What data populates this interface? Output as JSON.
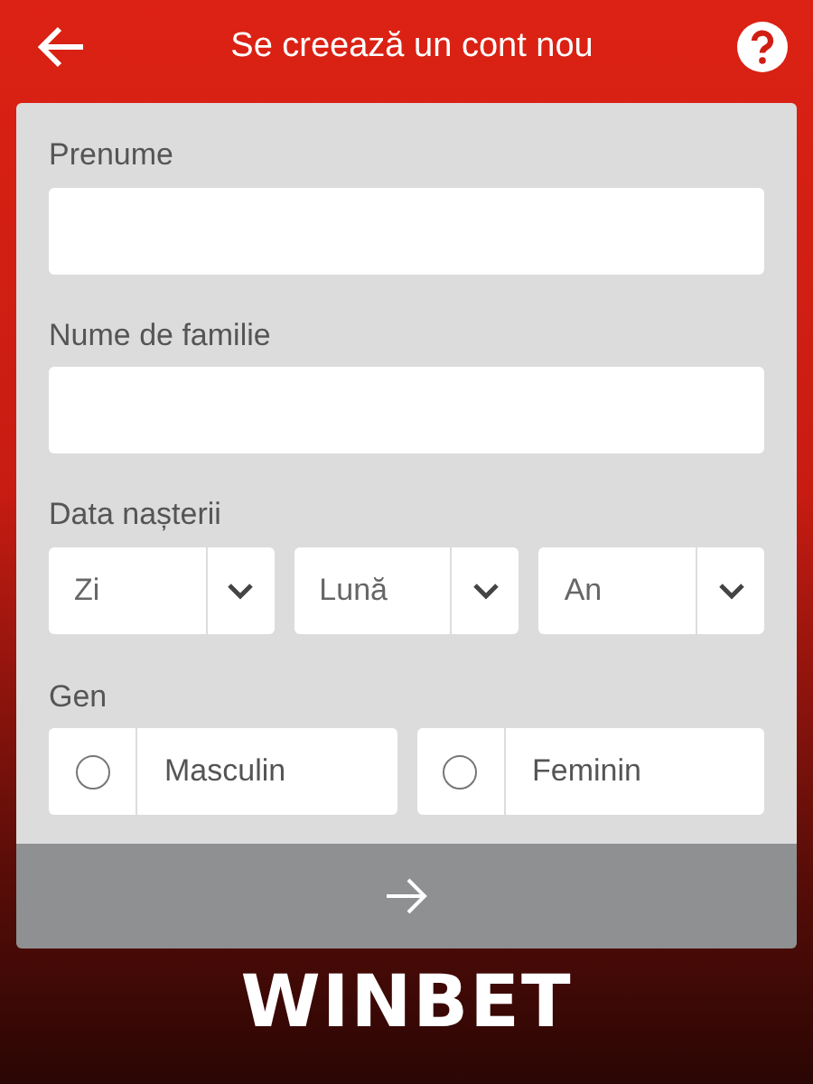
{
  "header": {
    "title": "Se creează un cont nou"
  },
  "fields": [
    {
      "label": "Prenume"
    },
    {
      "label": "Nume de familie"
    }
  ],
  "birth_date": {
    "label": "Data nașterii",
    "selects": [
      {
        "placeholder": "Zi"
      },
      {
        "placeholder": "Lună"
      },
      {
        "placeholder": "An"
      }
    ]
  },
  "gender": {
    "label": "Gen",
    "options": [
      {
        "label": "Masculin",
        "selected": false
      },
      {
        "label": "Feminin",
        "selected": false
      }
    ]
  },
  "logo": {
    "text": "WINBET"
  }
}
